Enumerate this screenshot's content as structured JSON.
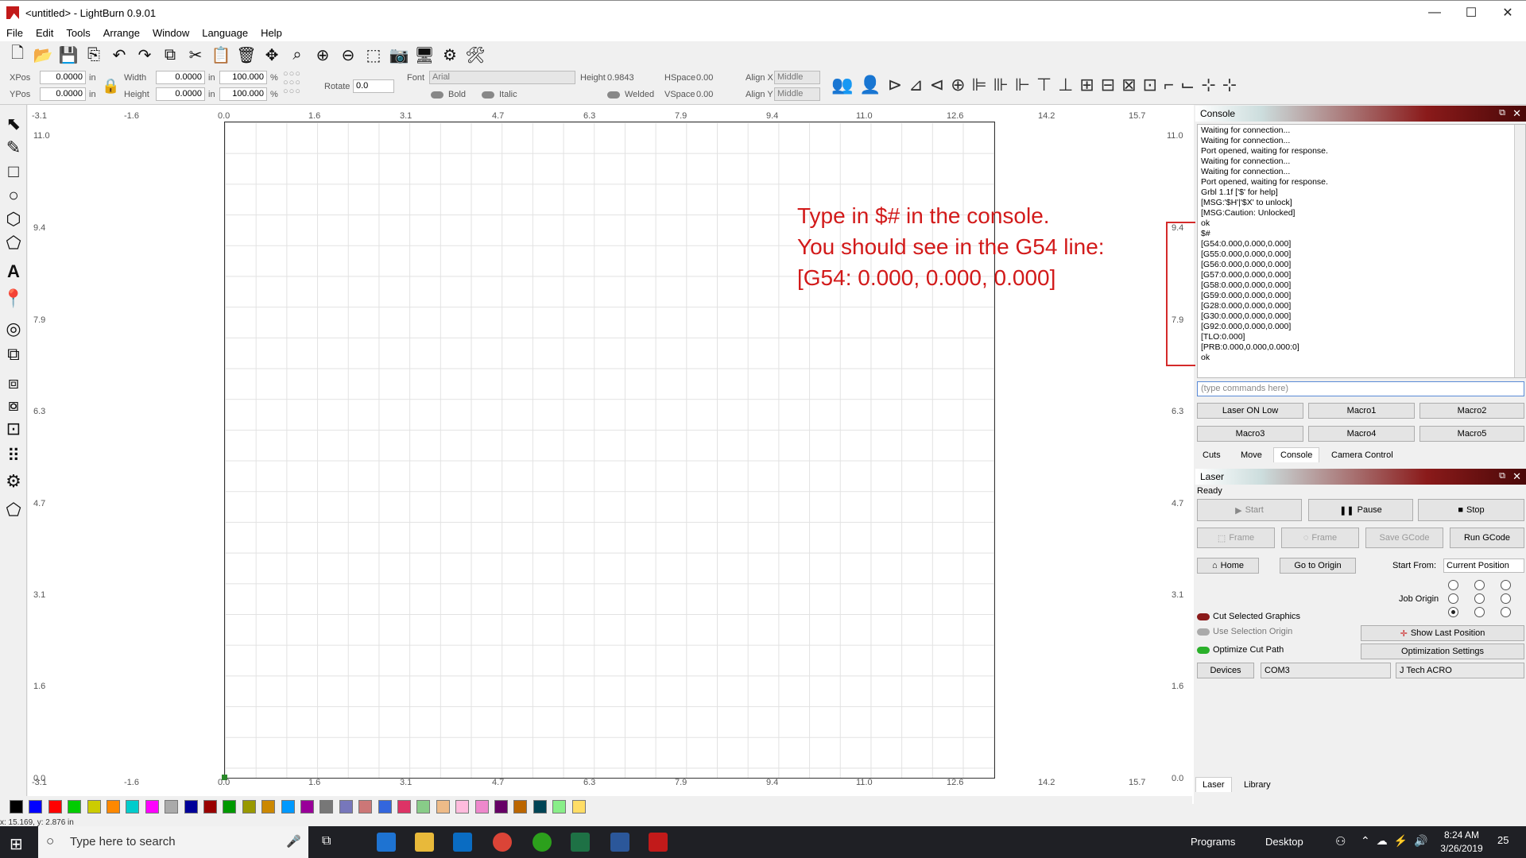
{
  "window": {
    "title": "<untitled> - LightBurn 0.9.01",
    "min": "—",
    "max": "☐",
    "close": "✕"
  },
  "menu": [
    "File",
    "Edit",
    "Tools",
    "Arrange",
    "Window",
    "Language",
    "Help"
  ],
  "toolbar2": {
    "xpos_label": "XPos",
    "xpos": "0.0000",
    "ypos_label": "YPos",
    "ypos": "0.0000",
    "unit": "in",
    "width_label": "Width",
    "width": "0.0000",
    "height_label": "Height",
    "height": "0.0000",
    "scale_w": "100.000",
    "scale_h": "100.000",
    "pct": "%",
    "rotate_label": "Rotate",
    "rotate": "0.0",
    "font_label": "Font",
    "font": "Arial",
    "fheight_label": "Height",
    "fheight": "0.9843",
    "hspace_label": "HSpace",
    "hspace": "0.00",
    "vspace_label": "VSpace",
    "vspace": "0.00",
    "alignx_label": "Align X",
    "aligny_label": "Align Y",
    "align_x": "Middle",
    "align_y": "Middle",
    "bold": "Bold",
    "italic": "Italic",
    "welded": "Welded"
  },
  "ruler": {
    "top": [
      "-3.1",
      "-1.6",
      "0.0",
      "1.6",
      "3.1",
      "4.7",
      "6.3",
      "7.9",
      "9.4",
      "11.0",
      "12.6",
      "14.2",
      "15.7"
    ],
    "left": [
      "11.0",
      "9.4",
      "7.9",
      "6.3",
      "4.7",
      "3.1",
      "1.6",
      "0.0"
    ],
    "corner": "0.0",
    "bottom_origin": "-3.1"
  },
  "annotation": "Type in $# in the console.\nYou should see in the G54 line:\n[G54: 0.000, 0.000, 0.000]",
  "console": {
    "title": "Console",
    "lines": [
      "Waiting for connection...",
      "Waiting for connection...",
      "Port opened, waiting for response.",
      "Waiting for connection...",
      "Waiting for connection...",
      "Port opened, waiting for response.",
      "Grbl 1.1f ['$' for help]",
      "[MSG:'$H'|'$X' to unlock]",
      "[MSG:Caution: Unlocked]",
      "ok",
      "$#",
      "[G54:0.000,0.000,0.000]",
      "[G55:0.000,0.000,0.000]",
      "[G56:0.000,0.000,0.000]",
      "[G57:0.000,0.000,0.000]",
      "[G58:0.000,0.000,0.000]",
      "[G59:0.000,0.000,0.000]",
      "[G28:0.000,0.000,0.000]",
      "[G30:0.000,0.000,0.000]",
      "[G92:0.000,0.000,0.000]",
      "[TLO:0.000]",
      "[PRB:0.000,0.000,0.000:0]",
      "ok"
    ],
    "placeholder": "(type commands here)",
    "macros": [
      "Laser ON Low",
      "Macro1",
      "Macro2",
      "Macro3",
      "Macro4",
      "Macro5"
    ],
    "tabs": [
      "Cuts",
      "Move",
      "Console",
      "Camera Control"
    ]
  },
  "laser": {
    "title": "Laser",
    "status": "Ready",
    "start": "Start",
    "pause": "Pause",
    "stop": "Stop",
    "frame1": "Frame",
    "frame2": "Frame",
    "save_gcode": "Save GCode",
    "run_gcode": "Run GCode",
    "home": "Home",
    "go_origin": "Go to Origin",
    "start_from_label": "Start From:",
    "start_from": "Current Position",
    "job_origin": "Job Origin",
    "cut_selected": "Cut Selected Graphics",
    "use_selection": "Use Selection Origin",
    "optimize": "Optimize Cut Path",
    "show_last": "Show Last Position",
    "opt_settings": "Optimization Settings",
    "devices": "Devices",
    "port": "COM3",
    "device": "J Tech ACRO",
    "tabs": [
      "Laser",
      "Library"
    ]
  },
  "palette": [
    "#000000",
    "#0000ff",
    "#ff0000",
    "#00cc00",
    "#cccc00",
    "#ff8800",
    "#00cccc",
    "#ff00ff",
    "#aaaaaa",
    "#000099",
    "#990000",
    "#009900",
    "#999900",
    "#cc8800",
    "#0099ff",
    "#990099",
    "#777777",
    "#7777bb",
    "#cc7777",
    "#3366dd",
    "#dd3366",
    "#88cc88",
    "#eebb88",
    "#ffbbdd",
    "#ee88cc",
    "#660066",
    "#bb6600",
    "#004455",
    "#88ee88",
    "#ffdd66"
  ],
  "status_text": "x: 15.169, y: 2.876 in",
  "taskbar": {
    "search_placeholder": "Type here to search",
    "programs": "Programs",
    "desktop": "Desktop",
    "time": "8:24 AM",
    "date": "3/26/2019",
    "notif": "25"
  }
}
